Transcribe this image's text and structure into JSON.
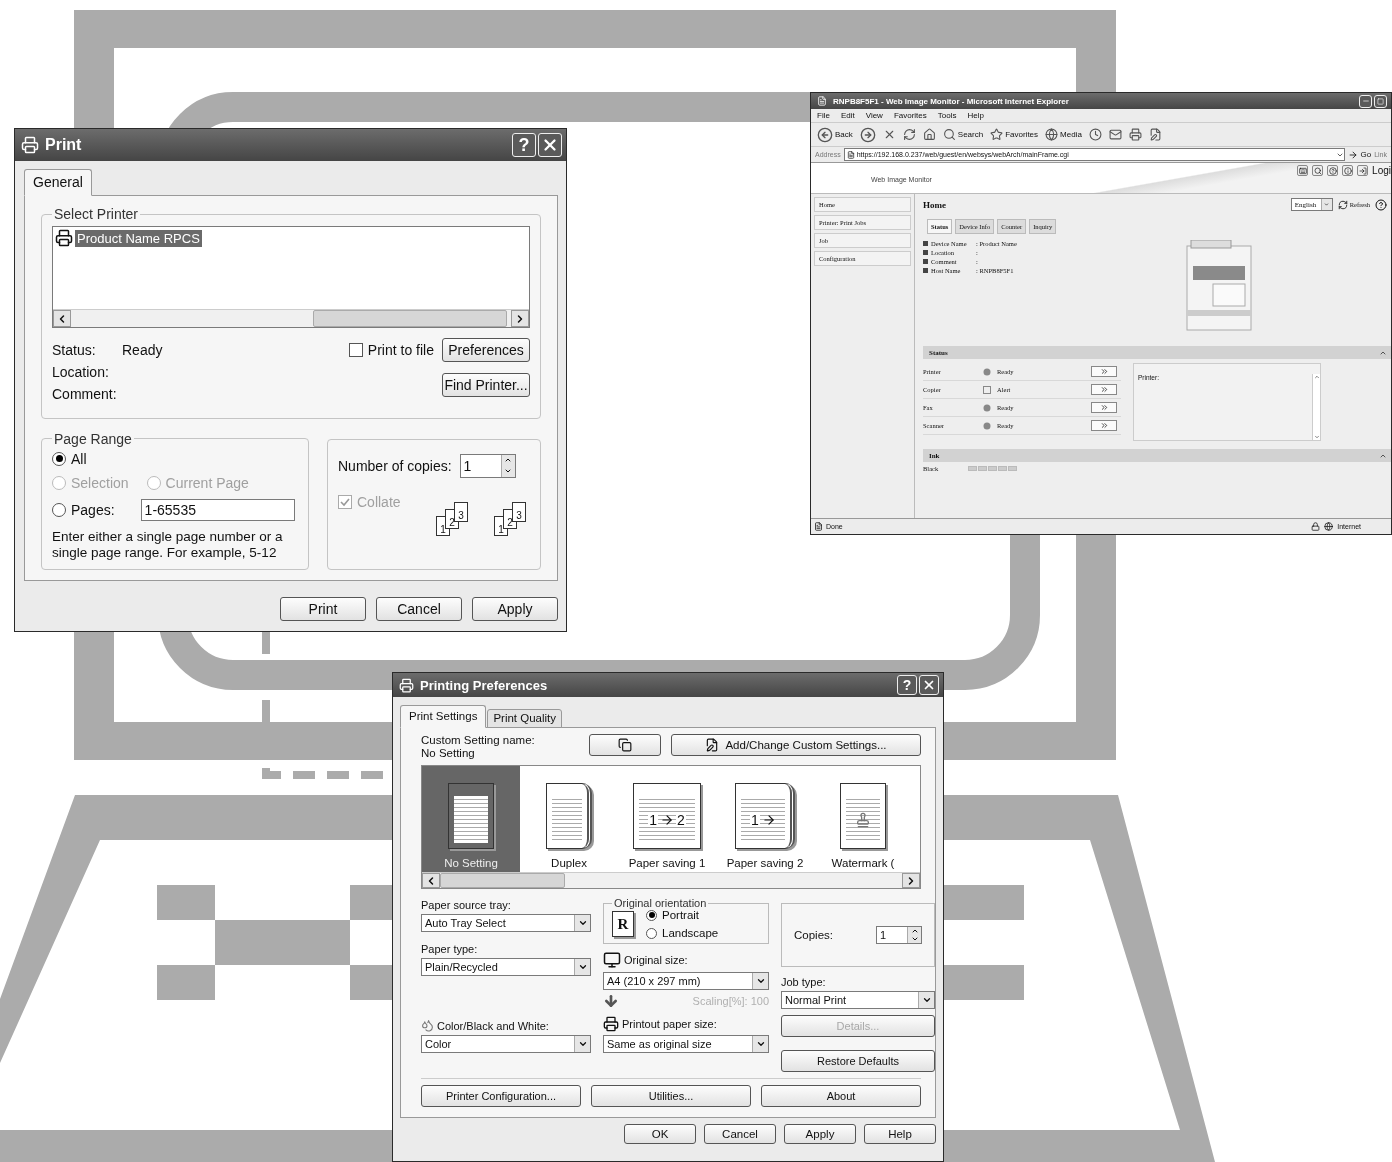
{
  "print_dialog": {
    "title": "Print",
    "help": "?",
    "tabs": [
      {
        "label": "General",
        "selected": true
      }
    ],
    "select_printer": {
      "legend": "Select Printer",
      "printers": [
        {
          "name": "Product Name RPCS",
          "selected": true
        }
      ],
      "info": [
        {
          "label": "Status:",
          "value": "Ready"
        },
        {
          "label": "Location:"
        },
        {
          "label": "Comment:"
        }
      ],
      "print_to_file": {
        "label": "Print to file",
        "checked": false
      },
      "preferences": "Preferences",
      "find_printer": "Find Printer..."
    },
    "page_range": {
      "legend": "Page Range",
      "options": [
        {
          "label": "All",
          "selected": true,
          "disabled": false
        },
        {
          "label": "Selection",
          "selected": false,
          "disabled": true
        },
        {
          "label": "Current Page",
          "selected": false,
          "disabled": true
        },
        {
          "label": "Pages:",
          "selected": false,
          "disabled": false
        }
      ],
      "pages_value": "1-65535",
      "hint": "Enter either a single page number or a single page range.  For example, 5-12"
    },
    "copies": {
      "label": "Number of copies:",
      "value": "1",
      "collate": {
        "label": "Collate",
        "checked": true,
        "disabled": true
      },
      "collate_sets": [
        [
          "1",
          "2",
          "3"
        ],
        [
          "1",
          "2",
          "3"
        ]
      ]
    },
    "buttons": [
      "Print",
      "Cancel",
      "Apply"
    ]
  },
  "browser": {
    "title": "RNPB8F5F1 - Web Image Monitor - Microsoft Internet Explorer",
    "menu": [
      "File",
      "Edit",
      "View",
      "Favorites",
      "Tools",
      "Help"
    ],
    "toolbar": [
      {
        "kind": "back",
        "label": "Back"
      },
      {
        "kind": "forward"
      },
      {
        "kind": "stop"
      },
      {
        "kind": "refresh"
      },
      {
        "kind": "home"
      },
      {
        "kind": "search",
        "label": "Search"
      },
      {
        "kind": "favorites",
        "label": "Favorites"
      },
      {
        "kind": "media",
        "label": "Media"
      },
      {
        "kind": "history"
      },
      {
        "kind": "mail"
      },
      {
        "kind": "print"
      },
      {
        "kind": "edit"
      }
    ],
    "address": {
      "label": "Address",
      "url": "https://192.168.0.237/web/guest/en/websys/webArch/mainFrame.cgi",
      "go": "Go",
      "links": "Link"
    },
    "header": {
      "brand": "Web Image Monitor",
      "logout": "Logi"
    },
    "sidebar": [
      "Home",
      "Printer: Print Jobs",
      "Job",
      "Configuration"
    ],
    "page": {
      "heading": "Home",
      "language": "English",
      "refresh": "Refresh",
      "tabs": [
        {
          "label": "Status",
          "selected": true
        },
        {
          "label": "Device Info",
          "selected": false
        },
        {
          "label": "Counter",
          "selected": false
        },
        {
          "label": "Inquiry",
          "selected": false
        }
      ],
      "device_info": [
        {
          "label": "Device Name",
          "value": ": Product Name"
        },
        {
          "label": "Location",
          "value": ":"
        },
        {
          "label": "Comment",
          "value": ":"
        },
        {
          "label": "Host Name",
          "value": ": RNPB8F5F1"
        }
      ],
      "status_section": {
        "title": "Status",
        "rows": [
          {
            "name": "Printer",
            "kind": "ready",
            "state": "Ready"
          },
          {
            "name": "Copier",
            "kind": "alert",
            "state": "Alert"
          },
          {
            "name": "Fax",
            "kind": "ready",
            "state": "Ready"
          },
          {
            "name": "Scanner",
            "kind": "ready",
            "state": "Ready"
          }
        ],
        "message_label": "Printer:"
      },
      "ink_section": {
        "title": "Ink",
        "rows": [
          "Black"
        ]
      }
    },
    "status_bar": {
      "text": "Done",
      "zone": "Internet"
    }
  },
  "printing_preferences": {
    "title": "Printing Preferences",
    "help": "?",
    "tabs": [
      {
        "label": "Print Settings",
        "selected": true
      },
      {
        "label": "Print Quality",
        "selected": false
      }
    ],
    "custom_setting": {
      "label": "Custom Setting name:",
      "value": "No Setting",
      "add_button": "Add/Change Custom Settings..."
    },
    "presets": [
      {
        "kind": "plain",
        "label": "No Setting",
        "selected": true
      },
      {
        "kind": "duplex",
        "label": "Duplex",
        "selected": false
      },
      {
        "kind": "combine",
        "label": "Paper saving 1",
        "selected": false,
        "digits": [
          "1",
          "2"
        ]
      },
      {
        "kind": "combine_duplex",
        "label": "Paper saving 2",
        "selected": false,
        "digits": [
          "1"
        ]
      },
      {
        "kind": "watermark",
        "label": "Watermark (",
        "selected": false
      }
    ],
    "paper_source": {
      "label": "Paper source tray:",
      "value": "Auto Tray Select"
    },
    "paper_type": {
      "label": "Paper type:",
      "value": "Plain/Recycled"
    },
    "color_mode": {
      "label": "Color/Black and White:",
      "value": "Color"
    },
    "orientation": {
      "legend": "Original orientation",
      "glyph": "R",
      "options": [
        {
          "label": "Portrait",
          "selected": true
        },
        {
          "label": "Landscape",
          "selected": false
        }
      ]
    },
    "original_size": {
      "label": "Original size:",
      "value": "A4 (210 x 297 mm)"
    },
    "scaling": {
      "text": "Scaling[%]: 100",
      "disabled": true
    },
    "printout_size": {
      "label": "Printout paper size:",
      "value": "Same as original size"
    },
    "copies": {
      "label": "Copies:",
      "value": "1"
    },
    "job_type": {
      "label": "Job type:",
      "value": "Normal Print"
    },
    "details": {
      "label": "Details...",
      "disabled": true
    },
    "restore": "Restore Defaults",
    "utility_buttons": [
      "Printer Configuration...",
      "Utilities...",
      "About"
    ],
    "buttons": [
      "OK",
      "Cancel",
      "Apply",
      "Help"
    ]
  }
}
